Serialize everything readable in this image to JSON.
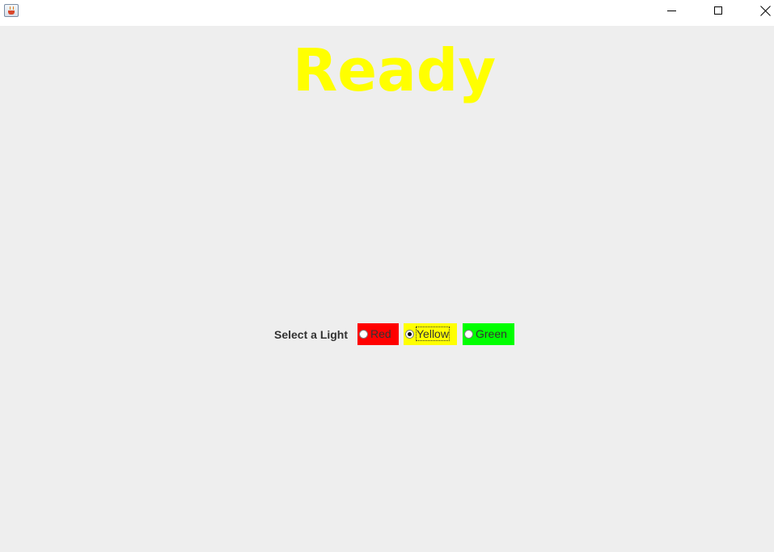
{
  "window": {
    "title": "",
    "icon": "java-coffee-cup-icon",
    "controls": [
      "minimize-icon",
      "maximize-icon",
      "close-icon"
    ]
  },
  "main": {
    "status_text": "Ready",
    "status_color": "#ffff00",
    "background_color": "#eeeeee"
  },
  "controls": {
    "prompt_label": "Select a Light",
    "selected": "Yellow",
    "options": [
      {
        "label": "Red",
        "color": "#ff0000",
        "checked": false
      },
      {
        "label": "Yellow",
        "color": "#ffff00",
        "checked": true
      },
      {
        "label": "Green",
        "color": "#00ff00",
        "checked": false
      }
    ]
  }
}
